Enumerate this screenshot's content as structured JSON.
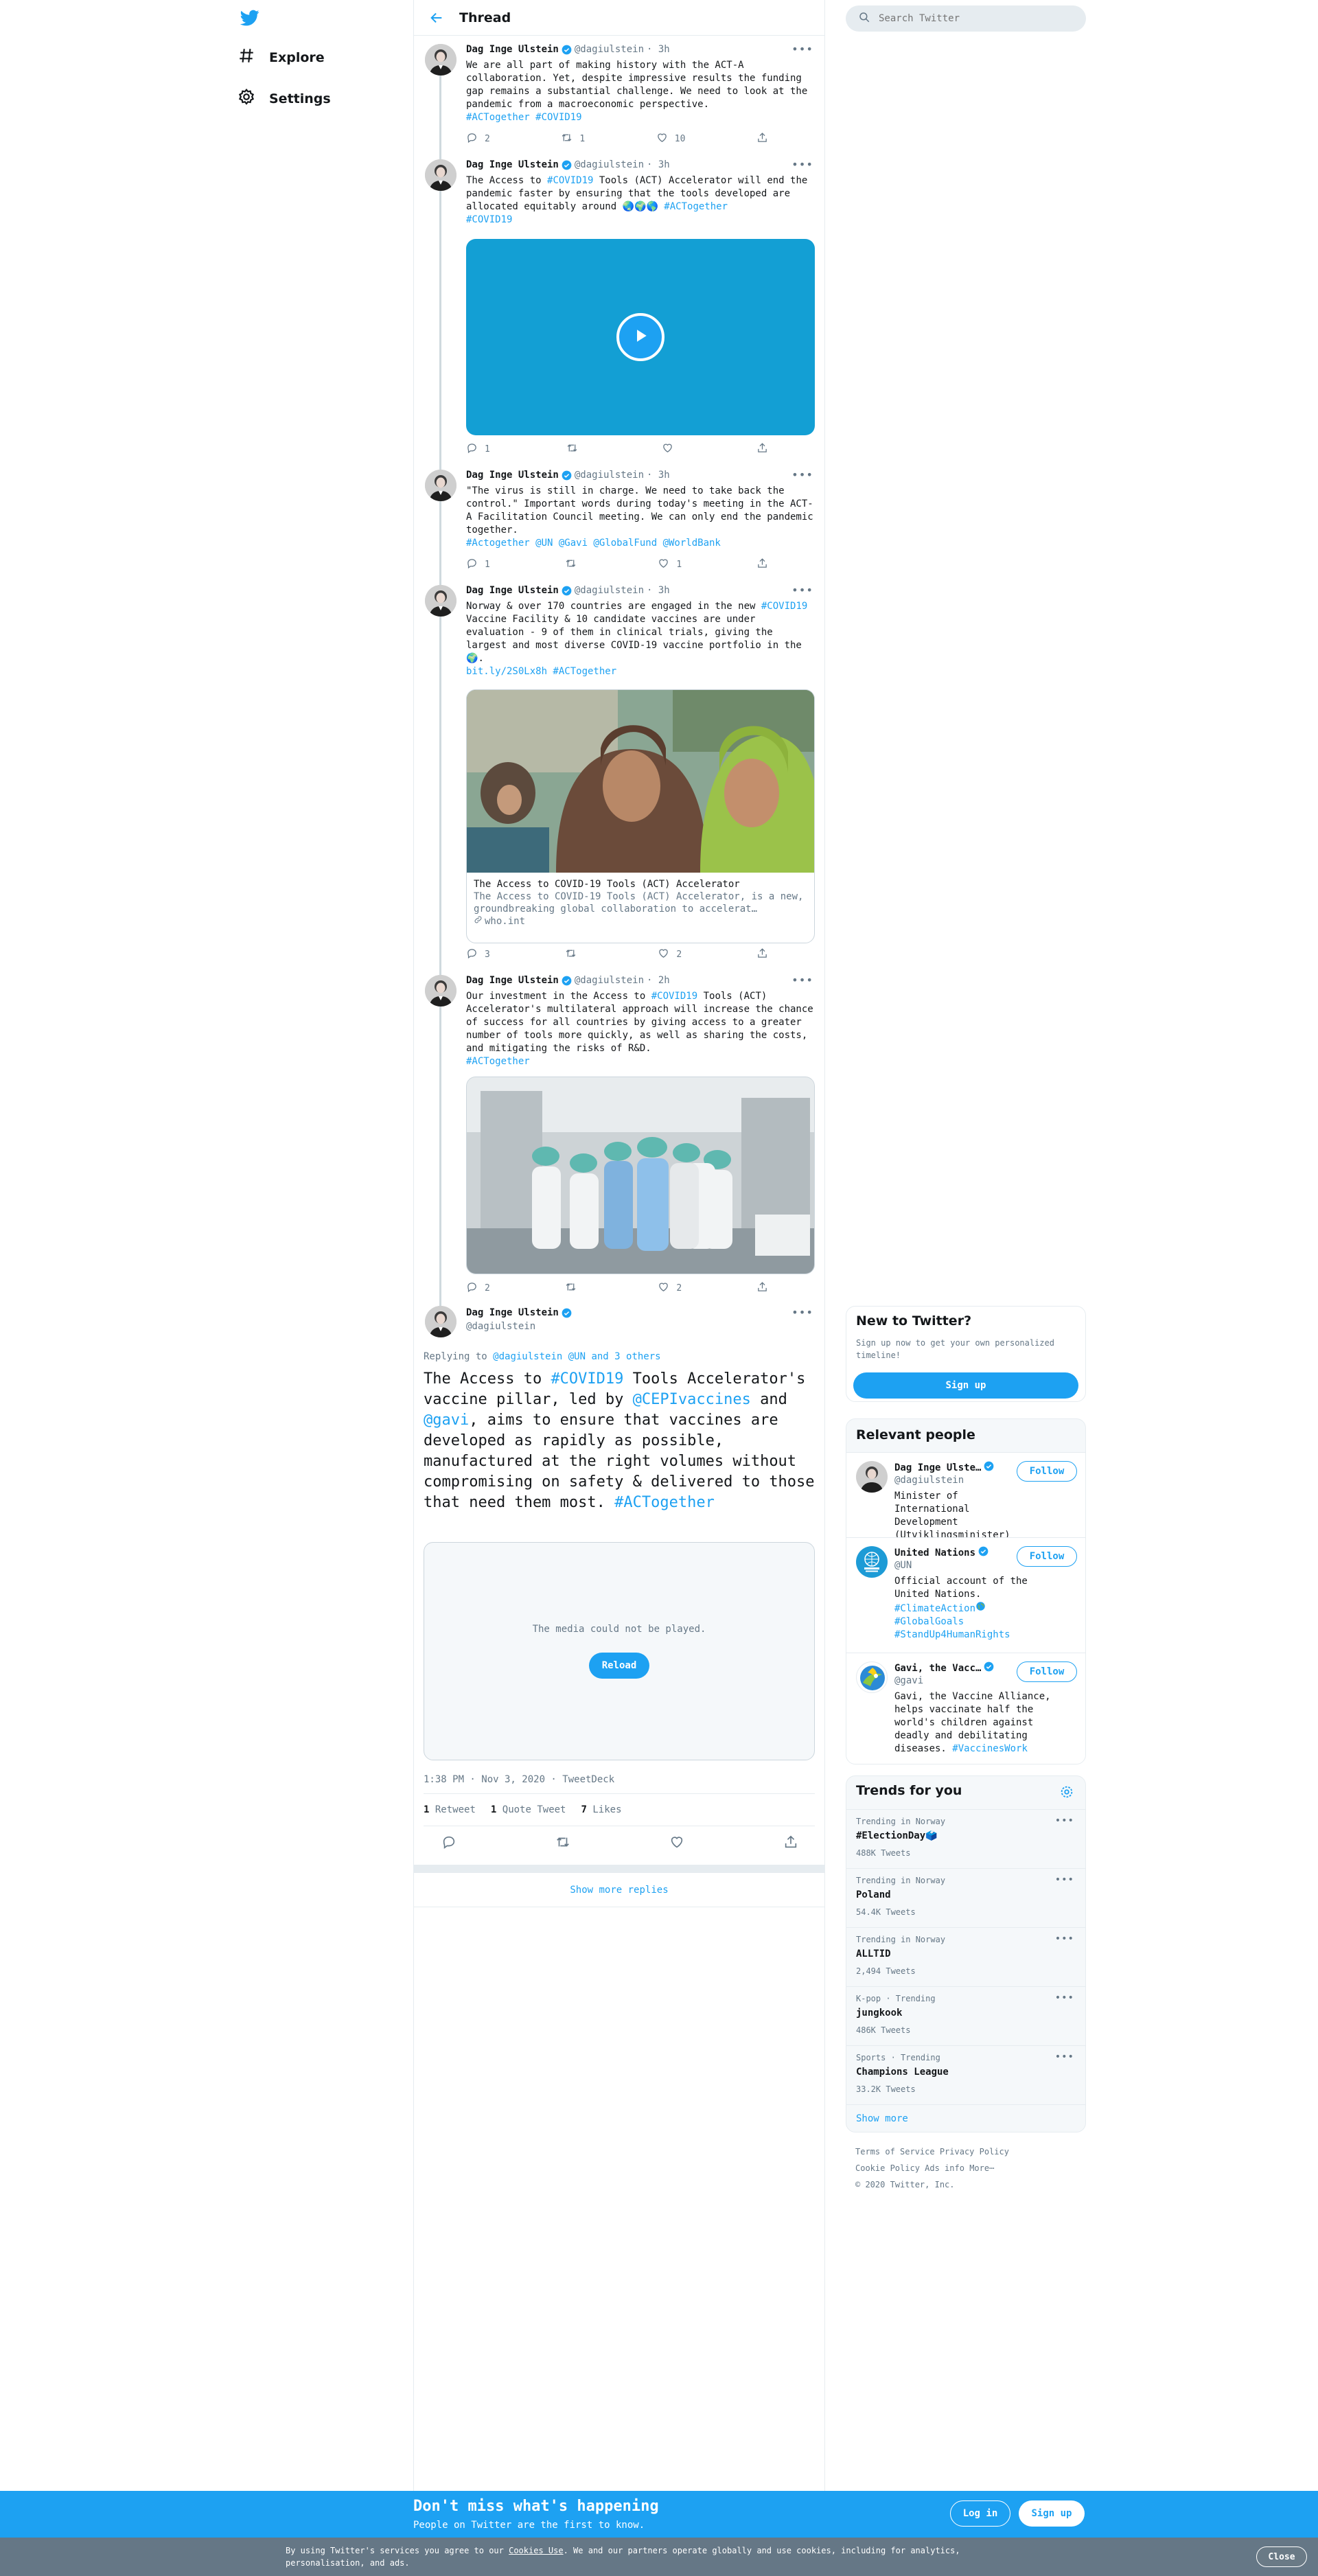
{
  "nav": {
    "explore": "Explore",
    "settings": "Settings"
  },
  "header": {
    "title": "Thread"
  },
  "search": {
    "placeholder": "Search Twitter"
  },
  "author": {
    "name": "Dag Inge Ulstein",
    "handle": "@dagiulstein"
  },
  "tweets": [
    {
      "time": "· 3h",
      "text": "We are all part of making history with the ACT-A collaboration. Yet, despite impressive results the funding gap remains a substantial challenge. We need to look at the pandemic from a macroeconomic perspective.",
      "tags": "#ACTogether #COVID19",
      "replies": "2",
      "retweets": "1",
      "likes": "10"
    },
    {
      "time": "· 3h",
      "text_a": "The Access to ",
      "tag_a": "#COVID19",
      "text_b": " Tools (ACT) Accelerator will end the pandemic faster by ensuring that the tools developed are allocated equitably around ",
      "emoji": "🌏🌍🌎",
      "tag_b": " #ACTogether",
      "tag_c": "#COVID19",
      "replies": "1",
      "retweets": "",
      "likes": ""
    },
    {
      "time": "· 3h",
      "text": "\"The virus is still in charge. We need to take back the control.\" Important words during today's meeting in the ACT-A Facilitation Council meeting. We can only end the pandemic together.",
      "tags": "#Actogether @UN @Gavi @GlobalFund @WorldBank",
      "replies": "1",
      "retweets": "",
      "likes": "1"
    },
    {
      "time": "· 3h",
      "text_a": "Norway & over 170 countries are engaged in the new ",
      "tag_a": "#COVID19",
      "text_b": " Vaccine Facility & 10 candidate vaccines are under evaluation - 9 of them in clinical trials, giving the largest and most diverse COVID-19 vaccine portfolio in the ",
      "emoji": "🌍",
      "text_c": ".",
      "links": "bit.ly/2S0Lx8h #ACTogether",
      "card_title": "The Access to COVID-19 Tools (ACT) Accelerator",
      "card_desc": "The Access to COVID-19 Tools (ACT) Accelerator, is a new, groundbreaking global collaboration to accelerat…",
      "card_domain": "who.int",
      "replies": "3",
      "retweets": "",
      "likes": "2"
    },
    {
      "time": "· 2h",
      "text_a": "Our investment in the Access to ",
      "tag_a": "#COVID19",
      "text_b": " Tools (ACT) Accelerator's multilateral approach will increase the chance of success for all countries by giving access to a greater number of tools more quickly, as well as sharing the costs, and mitigating the risks of R&D.",
      "tags": "#ACTogether",
      "replies": "2",
      "retweets": "",
      "likes": "2"
    }
  ],
  "main_tweet": {
    "replying_label": "Replying to",
    "replying_to": "@dagiulstein @UN and 3 others",
    "text_1": "The Access to ",
    "tag_1": "#COVID19",
    "text_2": " Tools Accelerator's vaccine pillar, led by ",
    "tag_2": "@CEPIvaccines",
    "text_3": " and ",
    "tag_3": "@gavi",
    "text_4": ", aims to ensure that vaccines are developed as rapidly as possible, manufactured at the right volumes without compromising on safety & delivered to those that need them most.",
    "tag_4": "#ACTogether",
    "media_error": "The media could not be played.",
    "reload": "Reload",
    "meta": "1:38 PM · Nov 3, 2020 · TweetDeck",
    "retweets_count": "1",
    "retweets_label": "Retweet",
    "quotes_count": "1",
    "quotes_label": "Quote Tweet",
    "likes_count": "7",
    "likes_label": "Likes"
  },
  "show_more": "Show more replies",
  "new_to_twitter": {
    "title": "New to Twitter?",
    "text": "Sign up now to get your own personalized timeline!",
    "signup": "Sign up"
  },
  "relevant": {
    "title": "Relevant people",
    "follow": "Follow",
    "people": [
      {
        "name": "Dag Inge Ulste…",
        "handle": "@dagiulstein",
        "bio": "Minister of International Development (Utviklingsminister)"
      },
      {
        "name": "United Nations",
        "handle": "@UN",
        "bio": "Official account of the United Nations.",
        "bio_tags_1": "#ClimateAction",
        "bio_tags_2": "#GlobalGoals",
        "bio_tags_3": "#StandUp4HumanRights"
      },
      {
        "name": "Gavi, the Vacc…",
        "handle": "@gavi",
        "bio": "Gavi, the Vaccine Alliance, helps vaccinate half the world's children against deadly and debilitating diseases. ",
        "bio_tag": "#VaccinesWork"
      }
    ]
  },
  "trends": {
    "title": "Trends for you",
    "items": [
      {
        "context": "Trending in Norway",
        "name": "#ElectionDay",
        "emoji": "🗳️",
        "count": "488K Tweets"
      },
      {
        "context": "Trending in Norway",
        "name": "Poland",
        "count": "54.4K Tweets"
      },
      {
        "context": "Trending in Norway",
        "name": "ALLTID",
        "count": "2,494 Tweets"
      },
      {
        "context": "K-pop · Trending",
        "name": "jungkook",
        "count": "486K Tweets"
      },
      {
        "context": "Sports · Trending",
        "name": "Champions League",
        "count": "33.2K Tweets"
      }
    ],
    "show_more": "Show more"
  },
  "footer": {
    "terms": "Terms of Service",
    "privacy": "Privacy Policy",
    "cookie": "Cookie Policy",
    "ads": "Ads info",
    "more": "More",
    "copyright": "© 2020 Twitter, Inc."
  },
  "banner": {
    "title": "Don't miss what's happening",
    "subtitle": "People on Twitter are the first to know.",
    "login": "Log in",
    "signup": "Sign up"
  },
  "cookie_bar": {
    "text_a": "By using Twitter's services you agree to our ",
    "link": "Cookies Use",
    "text_b": ". We and our partners operate globally and use cookies, including for analytics, personalisation, and ads.",
    "close": "Close"
  },
  "colors": {
    "accent": "#1da1f2",
    "text": "#14171a",
    "muted": "#657786",
    "border": "#e6ecf0"
  }
}
